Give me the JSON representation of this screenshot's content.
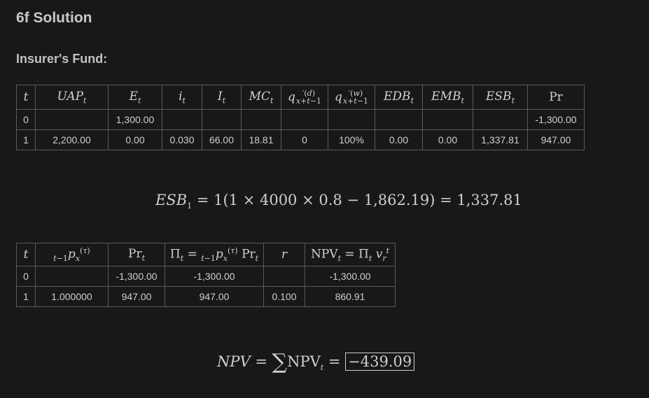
{
  "page": {
    "title": "6f Solution",
    "section": "Insurer's Fund:"
  },
  "table1": {
    "rows": [
      [
        "0",
        "",
        "1,300.00",
        "",
        "",
        "",
        "",
        "",
        "",
        "",
        "",
        "-1,300.00"
      ],
      [
        "1",
        "2,200.00",
        "0.00",
        "0.030",
        "66.00",
        "18.81",
        "0",
        "100%",
        "0.00",
        "0.00",
        "1,337.81",
        "947.00"
      ]
    ]
  },
  "equation1": {
    "lhs": "ESB",
    "lhs_sub": "1",
    "rhs": "= 1(1 × 4000 × 0.8 − 1,862.19) = 1,337.81"
  },
  "table2": {
    "rows": [
      [
        "0",
        "",
        "-1,300.00",
        "-1,300.00",
        "",
        "-1,300.00"
      ],
      [
        "1",
        "1.000000",
        "947.00",
        "947.00",
        "0.100",
        "860.91"
      ]
    ]
  },
  "equation2": {
    "lhs": "NPV",
    "eq": "=",
    "sigma": "∑",
    "term": "NPV",
    "term_sub": "t",
    "eq2": "=",
    "result": "−439.09"
  }
}
